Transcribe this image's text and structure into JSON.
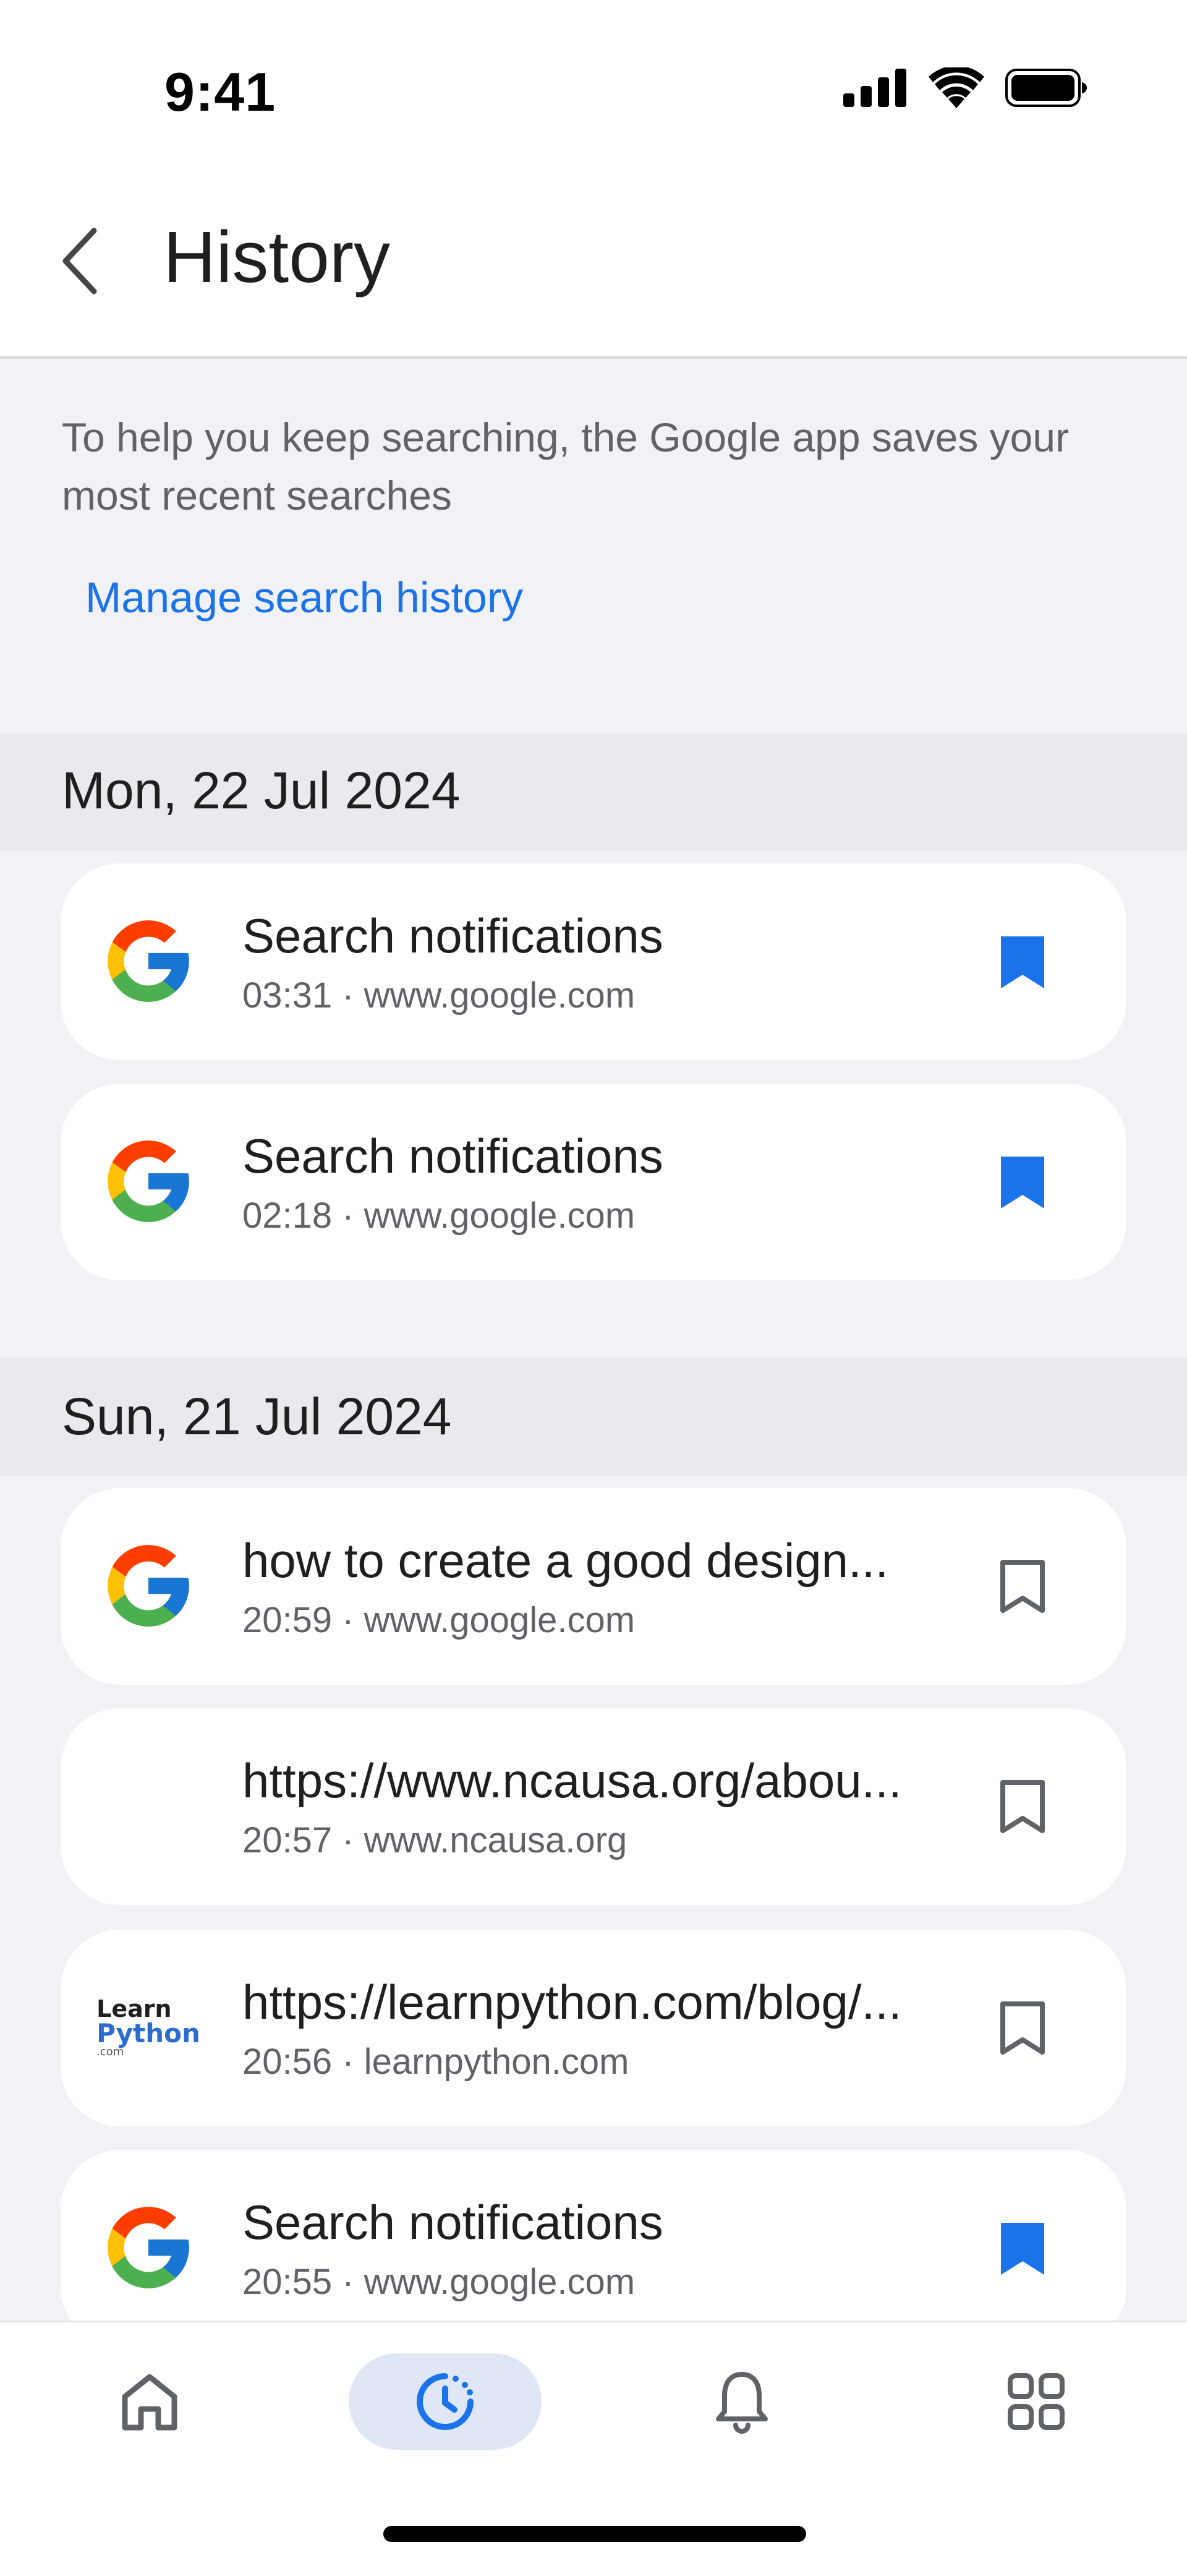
{
  "status_bar": {
    "time": "9:41"
  },
  "app_bar": {
    "title": "History"
  },
  "intro": {
    "text": "To help you keep searching, the Google app saves your most recent searches",
    "manage_link": "Manage search history"
  },
  "groups": [
    {
      "date": "Mon, 22 Jul 2024",
      "items": [
        {
          "title": "Search notifications",
          "subtitle": "03:31 · www.google.com",
          "icon": "google-g-icon",
          "bookmarked": true
        },
        {
          "title": "Search notifications",
          "subtitle": "02:18 · www.google.com",
          "icon": "google-g-icon",
          "bookmarked": true
        }
      ]
    },
    {
      "date": "Sun, 21 Jul 2024",
      "items": [
        {
          "title": "how to create a good design...",
          "subtitle": "20:59 · www.google.com",
          "icon": "google-g-icon",
          "bookmarked": false
        },
        {
          "title": "https://www.ncausa.org/abou...",
          "subtitle": "20:57 · www.ncausa.org",
          "icon": "none",
          "bookmarked": false
        },
        {
          "title": "https://learnpython.com/blog/...",
          "subtitle": "20:56 · learnpython.com",
          "icon": "learnpython-logo",
          "logo_text": [
            "Learn",
            "Python",
            ".com"
          ],
          "bookmarked": false
        },
        {
          "title": "Search notifications",
          "subtitle": "20:55 · www.google.com",
          "icon": "google-g-icon",
          "bookmarked": true
        }
      ]
    }
  ],
  "bottom_nav": [
    {
      "name": "home",
      "icon": "home-icon",
      "active": false
    },
    {
      "name": "history",
      "icon": "history-icon",
      "active": true
    },
    {
      "name": "notifications",
      "icon": "bell-icon",
      "active": false
    },
    {
      "name": "apps",
      "icon": "grid-icon",
      "active": false
    }
  ],
  "colors": {
    "accent": "#1a73e8",
    "background": "#f0f2f5",
    "card": "#ffffff",
    "date_band": "#e8eaed",
    "secondary_text": "#5f6368",
    "bookmark_filled": "#1a73e8",
    "bookmark_outline": "#5f6368"
  }
}
